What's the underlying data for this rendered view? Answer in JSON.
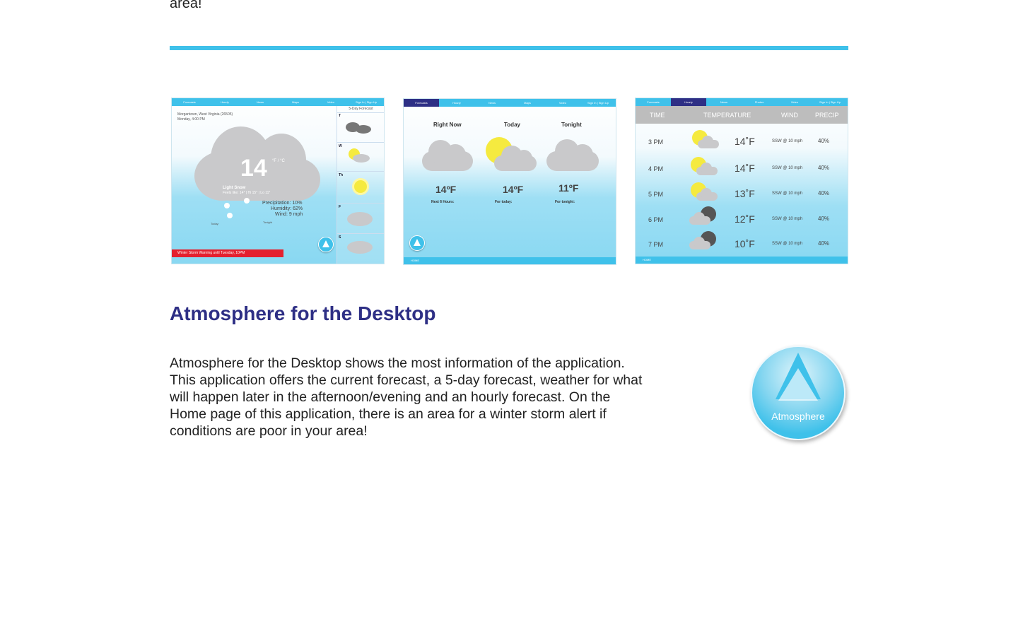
{
  "page": {
    "top_text": "area!",
    "heading": "Atmosphere for the Desktop",
    "body": "Atmosphere for the Desktop shows the most information of the application. This application offers the current forecast, a 5-day forecast, weather for what will happen later in the afternoon/evening and an hourly forecast. On the Home page of this application, there is an area for a winter storm alert if conditions are poor in your area!",
    "logo_label": "Atmosphere",
    "accent_color": "#3fc1ea",
    "heading_color": "#2e2f85"
  },
  "shot1": {
    "nav": [
      "Forecasts",
      "Hourly",
      "News",
      "Maps",
      "Video",
      "Sign In | Sign Up"
    ],
    "location": "Morgantown, West Virginia (26505)",
    "datetime": "Monday, 4:00 PM",
    "temp": "14",
    "units": "°F / °C",
    "condition": "Light Snow",
    "feels": "Feels like: 14° | Hi 15° | Lo 11°",
    "precip": "Precipitation: 10%",
    "humidity": "Humidity: 62%",
    "wind": "Wind: 9 mph",
    "today": "Today:",
    "tonight": "Tonight",
    "forecast_title": "5-Day Forecast",
    "days": [
      "T",
      "W",
      "Th",
      "F",
      "S"
    ],
    "alert": "Winter Storm Warning until Tuesday, 10PM"
  },
  "shot2": {
    "nav": [
      "Forecasts",
      "Hourly",
      "News",
      "Maps",
      "Video",
      "Sign In | Sign Up"
    ],
    "cols": [
      {
        "title": "Right Now",
        "temp": "14ºF",
        "sub": "Next 6 Hours:"
      },
      {
        "title": "Today",
        "temp": "14ºF",
        "sub": "For today:"
      },
      {
        "title": "Tonight",
        "temp": "11ºF",
        "sub": "For tonight:"
      }
    ],
    "home": "HOME"
  },
  "shot3": {
    "nav": [
      "Forecasts",
      "Hourly",
      "News",
      "Photos",
      "Video",
      "Sign In | Sign Up"
    ],
    "headers": [
      "TIME",
      "TEMPERATURE",
      "WIND",
      "PRECIP"
    ],
    "rows": [
      {
        "time": "3 PM",
        "temp": "14˚F",
        "wind": "SSW @ 10 mph",
        "precip": "40%",
        "icon": "sun-cloud"
      },
      {
        "time": "4 PM",
        "temp": "14˚F",
        "wind": "SSW @ 10 mph",
        "precip": "40%",
        "icon": "sun-cloud"
      },
      {
        "time": "5 PM",
        "temp": "13˚F",
        "wind": "SSW @ 10 mph",
        "precip": "40%",
        "icon": "sun-cloud"
      },
      {
        "time": "6 PM",
        "temp": "12˚F",
        "wind": "SSW @ 10 mph",
        "precip": "40%",
        "icon": "moon-cloud"
      },
      {
        "time": "7 PM",
        "temp": "10˚F",
        "wind": "SSW @ 10 mph",
        "precip": "40%",
        "icon": "moon-cloud"
      }
    ],
    "home": "HOME"
  }
}
